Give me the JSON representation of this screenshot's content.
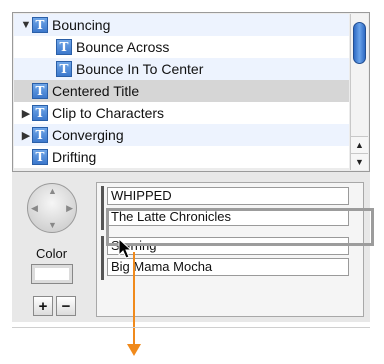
{
  "title_list": {
    "items": [
      {
        "label": "Bouncing",
        "disclosure": "open",
        "level": 0
      },
      {
        "label": "Bounce Across",
        "disclosure": "none",
        "level": 1
      },
      {
        "label": "Bounce In To Center",
        "disclosure": "none",
        "level": 1
      },
      {
        "label": "Centered Title",
        "disclosure": "none",
        "level": 0,
        "selected": true
      },
      {
        "label": "Clip to Characters",
        "disclosure": "closed",
        "level": 0
      },
      {
        "label": "Converging",
        "disclosure": "closed",
        "level": 0
      },
      {
        "label": "Drifting",
        "disclosure": "none",
        "level": 0
      }
    ],
    "icon_letter": "T",
    "disclosure_open_glyph": "▼",
    "disclosure_closed_glyph": "▶",
    "scroll_up_glyph": "▲",
    "scroll_down_glyph": "▼"
  },
  "controls": {
    "color_label": "Color",
    "add_label": "+",
    "remove_label": "−"
  },
  "text_lines": [
    "WHIPPED",
    "The Latte Chronicles",
    "Starring",
    "Big Mama Mocha"
  ],
  "colors": {
    "selection": "#d6d6d6",
    "alt_row": "#edf3fe",
    "drag_arrow": "#f08a1c",
    "scroll_thumb": "#3c78cc"
  }
}
